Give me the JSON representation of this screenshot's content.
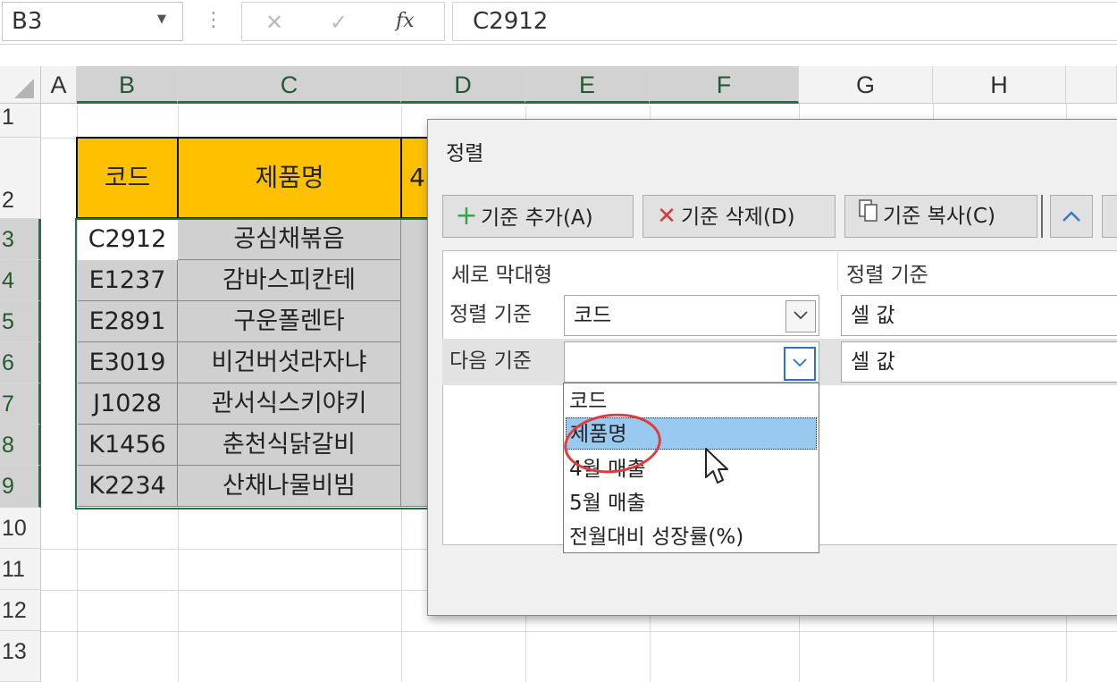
{
  "formula_bar": {
    "name_box": "B3",
    "fx_symbol": "fx",
    "cancel_glyph": "✕",
    "enter_glyph": "✓",
    "formula": "C2912"
  },
  "columns": [
    "A",
    "B",
    "C",
    "D",
    "E",
    "F",
    "G",
    "H"
  ],
  "rows": [
    "1",
    "2",
    "3",
    "4",
    "5",
    "6",
    "7",
    "8",
    "9",
    "10",
    "11",
    "12",
    "13"
  ],
  "table": {
    "headers": [
      "코드",
      "제품명",
      "4"
    ],
    "rows": [
      [
        "C2912",
        "공심채볶음"
      ],
      [
        "E1237",
        "감바스피칸테"
      ],
      [
        "E2891",
        "구운폴렌타"
      ],
      [
        "E3019",
        "비건버섯라자냐"
      ],
      [
        "J1028",
        "관서식스키야키"
      ],
      [
        "K1456",
        "춘천식닭갈비"
      ],
      [
        "K2234",
        "산채나물비빔"
      ]
    ]
  },
  "dialog": {
    "title": "정렬",
    "toolbar": {
      "add": "기준 추가(A)",
      "delete": "기준 삭제(D)",
      "copy": "기준 복사(C)",
      "up": "^"
    },
    "column_header": "세로 막대형",
    "sort_on_header": "정렬 기준",
    "levels": [
      {
        "label": "정렬 기준",
        "column": "코드",
        "sort_on": "셀 값"
      },
      {
        "label": "다음 기준",
        "column": "",
        "sort_on": "셀 값"
      }
    ],
    "dropdown_options": [
      "코드",
      "제품명",
      "4월 매출",
      "5월 매출",
      "전월대비 성장률(%)"
    ],
    "highlighted_option": "제품명"
  },
  "colors": {
    "header_fill": "#ffc000",
    "selection_green": "#217346",
    "highlight": "#99c9ef",
    "annotation": "#e03c3c"
  },
  "icons": [
    "dropdown-arrow-icon",
    "cancel-icon",
    "enter-icon",
    "function-icon",
    "plus-icon",
    "delete-x-icon",
    "copy-icon",
    "up-arrow-icon",
    "chevron-down-icon",
    "mouse-cursor-icon"
  ]
}
